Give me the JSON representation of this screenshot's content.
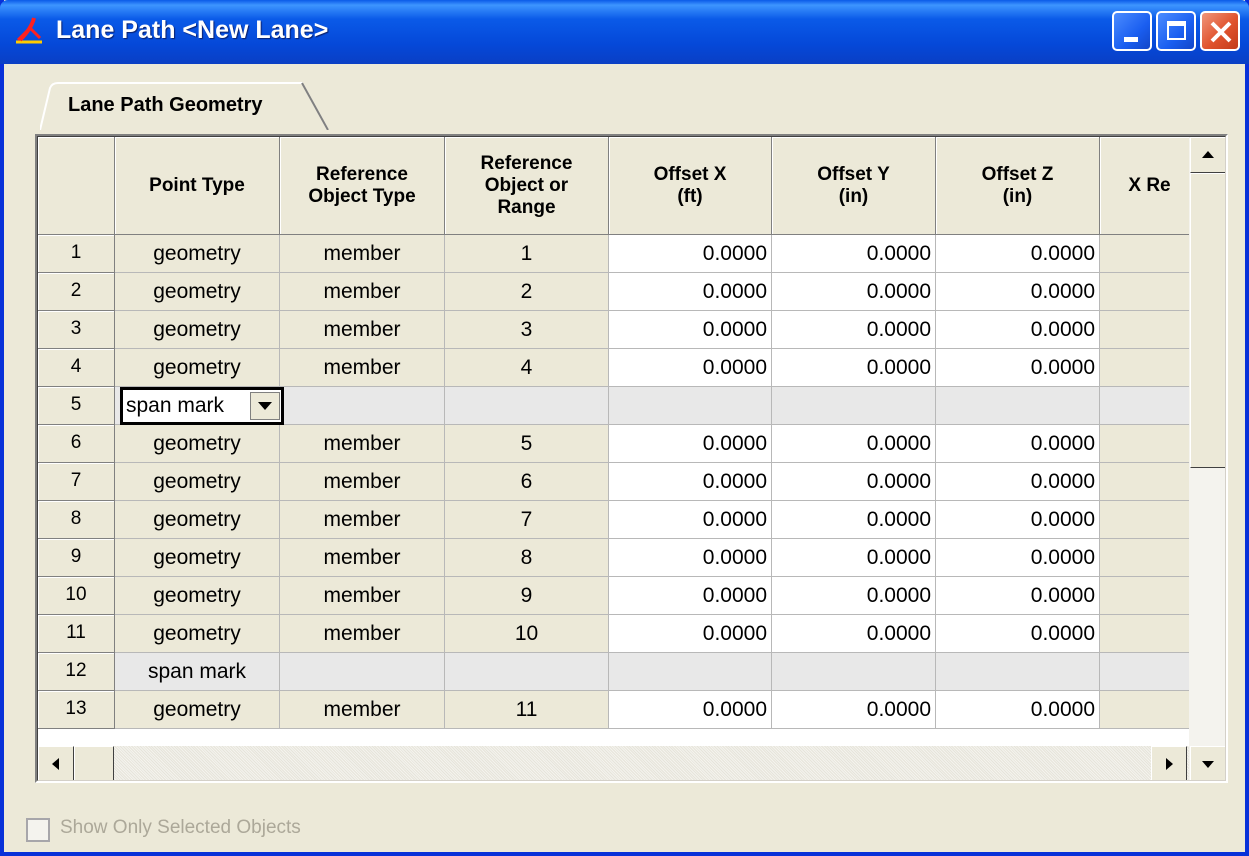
{
  "window": {
    "title": "Lane Path <New Lane>",
    "accent": "#0a5ae8",
    "close_color": "#e0532e"
  },
  "tabs": [
    {
      "label": "Lane Path Geometry",
      "active": true
    }
  ],
  "grid": {
    "columns": [
      "",
      "Point Type",
      "Reference\nObject Type",
      "Reference\nObject or\nRange",
      "Offset X\n(ft)",
      "Offset Y\n(in)",
      "Offset Z\n(in)",
      "X Re"
    ],
    "rows": [
      {
        "num": "1",
        "point_type": "geometry",
        "ref_type": "member",
        "ref": "1",
        "ox": "0.0000",
        "oy": "0.0000",
        "oz": "0.0000"
      },
      {
        "num": "2",
        "point_type": "geometry",
        "ref_type": "member",
        "ref": "2",
        "ox": "0.0000",
        "oy": "0.0000",
        "oz": "0.0000"
      },
      {
        "num": "3",
        "point_type": "geometry",
        "ref_type": "member",
        "ref": "3",
        "ox": "0.0000",
        "oy": "0.0000",
        "oz": "0.0000"
      },
      {
        "num": "4",
        "point_type": "geometry",
        "ref_type": "member",
        "ref": "4",
        "ox": "0.0000",
        "oy": "0.0000",
        "oz": "0.0000"
      },
      {
        "num": "5",
        "point_type": "span mark",
        "ref_type": "",
        "ref": "",
        "ox": "",
        "oy": "",
        "oz": ""
      },
      {
        "num": "6",
        "point_type": "geometry",
        "ref_type": "member",
        "ref": "5",
        "ox": "0.0000",
        "oy": "0.0000",
        "oz": "0.0000"
      },
      {
        "num": "7",
        "point_type": "geometry",
        "ref_type": "member",
        "ref": "6",
        "ox": "0.0000",
        "oy": "0.0000",
        "oz": "0.0000"
      },
      {
        "num": "8",
        "point_type": "geometry",
        "ref_type": "member",
        "ref": "7",
        "ox": "0.0000",
        "oy": "0.0000",
        "oz": "0.0000"
      },
      {
        "num": "9",
        "point_type": "geometry",
        "ref_type": "member",
        "ref": "8",
        "ox": "0.0000",
        "oy": "0.0000",
        "oz": "0.0000"
      },
      {
        "num": "10",
        "point_type": "geometry",
        "ref_type": "member",
        "ref": "9",
        "ox": "0.0000",
        "oy": "0.0000",
        "oz": "0.0000"
      },
      {
        "num": "11",
        "point_type": "geometry",
        "ref_type": "member",
        "ref": "10",
        "ox": "0.0000",
        "oy": "0.0000",
        "oz": "0.0000"
      },
      {
        "num": "12",
        "point_type": "span mark",
        "ref_type": "",
        "ref": "",
        "ox": "",
        "oy": "",
        "oz": ""
      },
      {
        "num": "13",
        "point_type": "geometry",
        "ref_type": "member",
        "ref": "11",
        "ox": "0.0000",
        "oy": "0.0000",
        "oz": "0.0000"
      }
    ],
    "editing_value": "span mark"
  },
  "footer": {
    "show_only_selected_label": "Show Only Selected Objects",
    "show_only_selected_checked": false
  }
}
